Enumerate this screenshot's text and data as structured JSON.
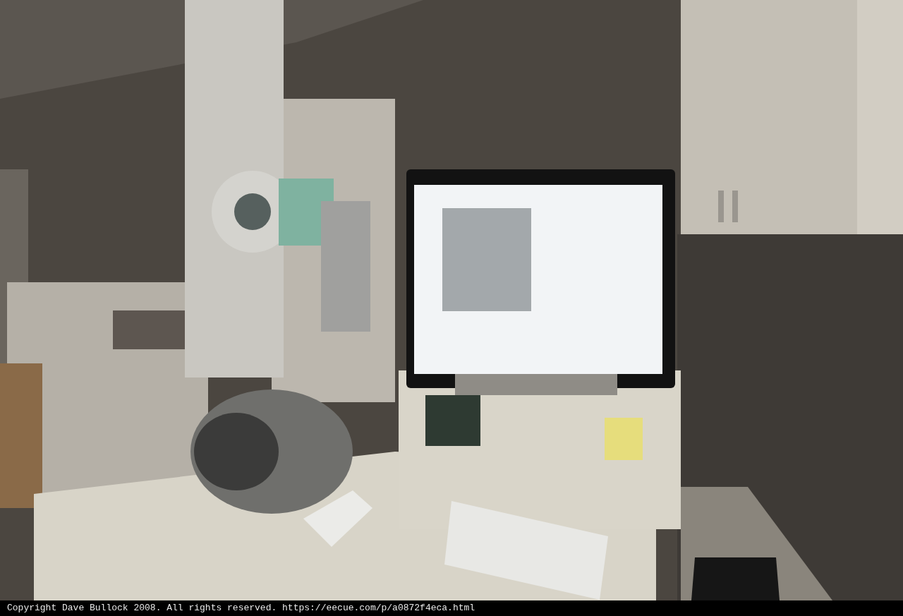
{
  "caption": {
    "text": "Copyright Dave Bullock 2008. All rights reserved. https://eecue.com/p/a0872f4eca.html"
  }
}
